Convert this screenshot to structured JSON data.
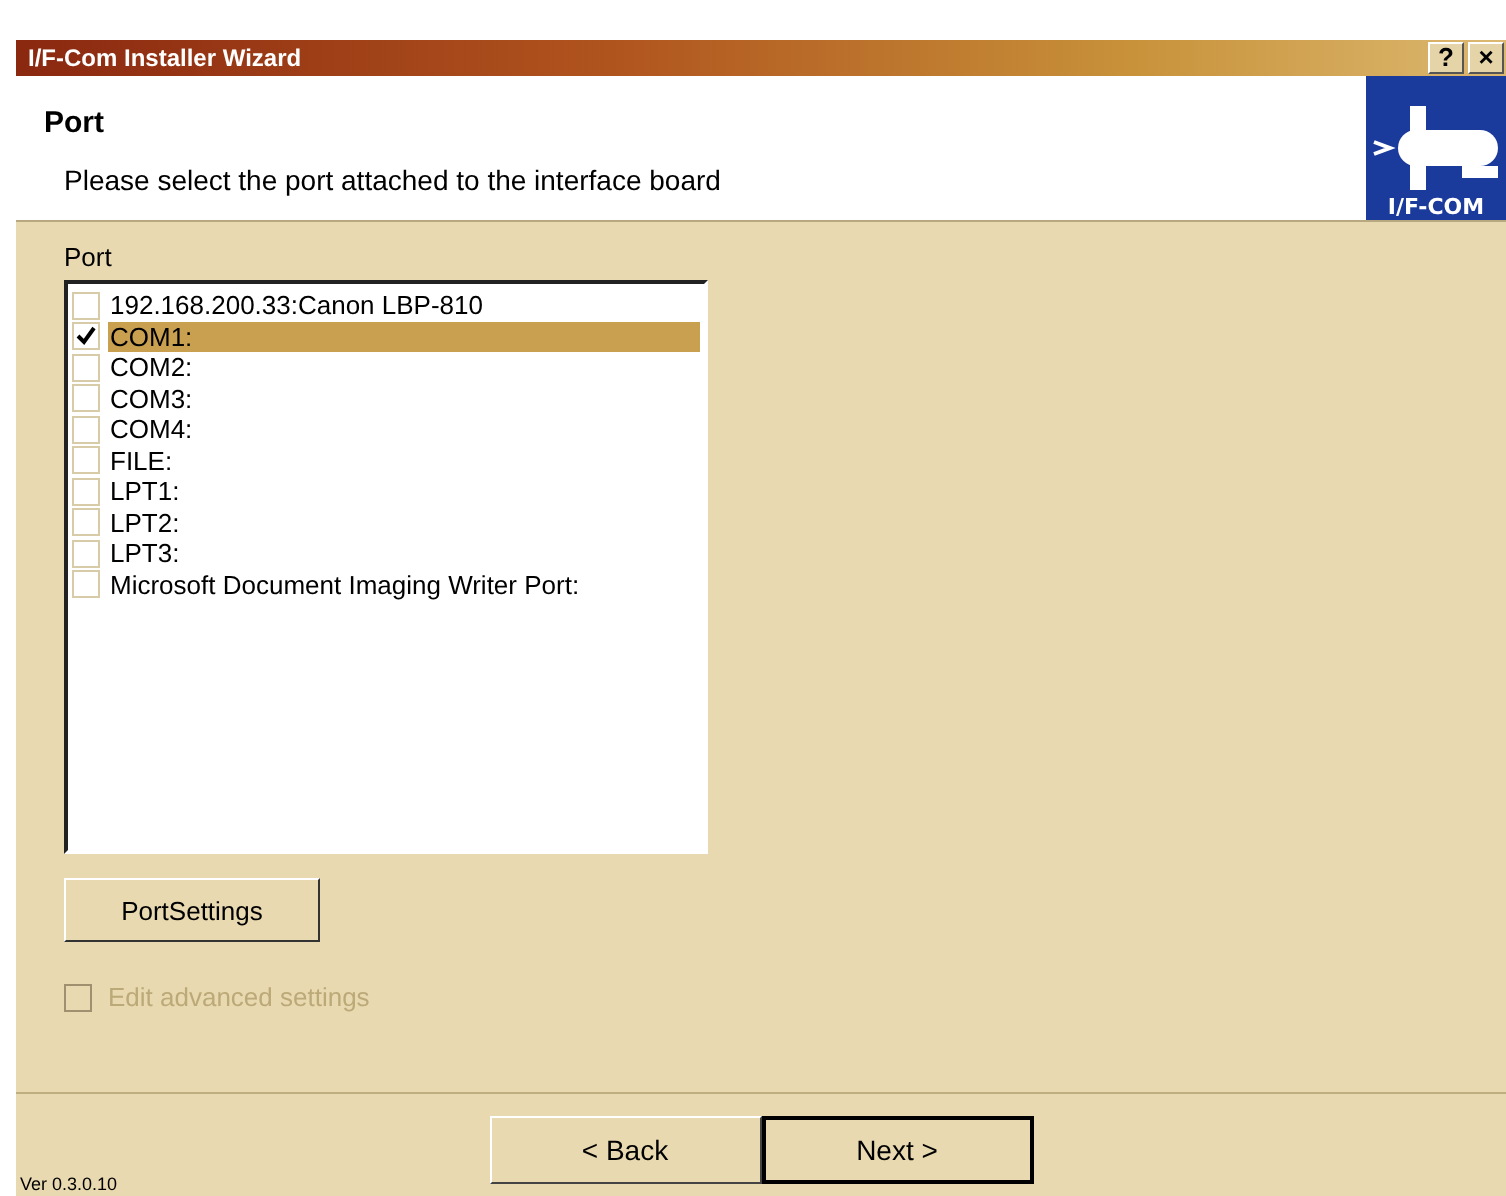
{
  "window": {
    "title": "I/F-Com Installer Wizard",
    "title_buttons": [
      "?",
      "×"
    ]
  },
  "header": {
    "title": "Port",
    "subtitle": "Please select the port attached to the interface board",
    "logo_text": "I/F-COM"
  },
  "port_label": "Port",
  "ports": [
    {
      "label": "192.168.200.33:Canon LBP-810",
      "checked": false,
      "selected": false
    },
    {
      "label": "COM1:",
      "checked": true,
      "selected": true
    },
    {
      "label": "COM2:",
      "checked": false,
      "selected": false
    },
    {
      "label": "COM3:",
      "checked": false,
      "selected": false
    },
    {
      "label": "COM4:",
      "checked": false,
      "selected": false
    },
    {
      "label": "FILE:",
      "checked": false,
      "selected": false
    },
    {
      "label": "LPT1:",
      "checked": false,
      "selected": false
    },
    {
      "label": "LPT2:",
      "checked": false,
      "selected": false
    },
    {
      "label": "LPT3:",
      "checked": false,
      "selected": false
    },
    {
      "label": "Microsoft Document Imaging Writer Port:",
      "checked": false,
      "selected": false
    }
  ],
  "port_settings_button": "PortSettings",
  "advanced": {
    "label": "Edit advanced settings",
    "checked": false,
    "disabled": true
  },
  "buttons": [
    {
      "label": "< Back",
      "default": false
    },
    {
      "label": "Next >",
      "default": true
    }
  ],
  "version": "Ver 0.3.0.10"
}
